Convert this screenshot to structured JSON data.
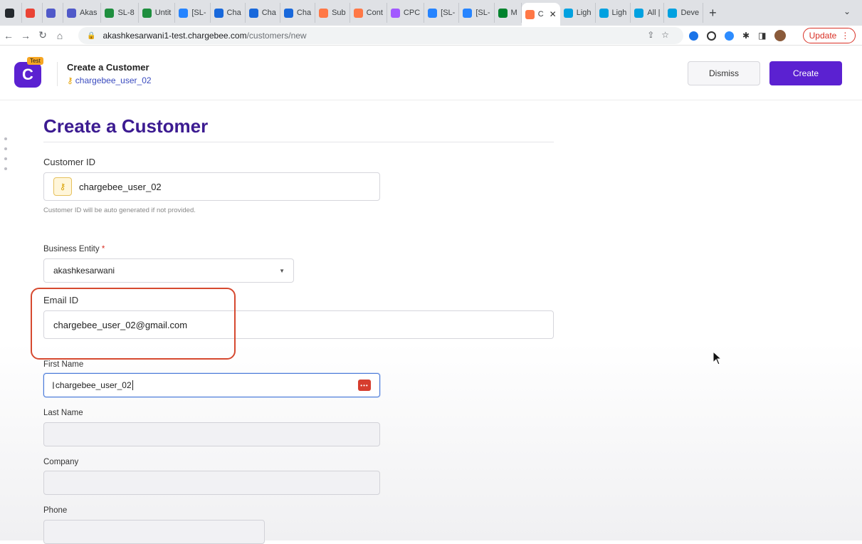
{
  "browser": {
    "tabs": [
      {
        "label": "",
        "icon": "github-icon",
        "color": "#24292e"
      },
      {
        "label": "",
        "icon": "gmail-icon",
        "color": "#ea4335"
      },
      {
        "label": "",
        "icon": "teams-icon",
        "color": "#5059c9"
      },
      {
        "label": "Akas",
        "icon": "teams-icon",
        "color": "#5059c9"
      },
      {
        "label": "SL-8",
        "icon": "sheets-icon",
        "color": "#1e8e3e"
      },
      {
        "label": "Untit",
        "icon": "sheets-icon",
        "color": "#1e8e3e"
      },
      {
        "label": "[SL-",
        "icon": "jira-icon",
        "color": "#2684ff"
      },
      {
        "label": "Cha",
        "icon": "confluence-icon",
        "color": "#1868db"
      },
      {
        "label": "Cha",
        "icon": "confluence-icon",
        "color": "#1868db"
      },
      {
        "label": "Cha",
        "icon": "confluence-icon",
        "color": "#1868db"
      },
      {
        "label": "Sub",
        "icon": "chargebee-icon",
        "color": "#ff7846"
      },
      {
        "label": "Cont",
        "icon": "chargebee-icon",
        "color": "#ff7846"
      },
      {
        "label": "CPC",
        "icon": "figma-icon",
        "color": "#a259ff"
      },
      {
        "label": "[SL-",
        "icon": "jira-icon",
        "color": "#2684ff"
      },
      {
        "label": "[SL-",
        "icon": "jira-icon",
        "color": "#2684ff"
      },
      {
        "label": "M",
        "icon": "meet-icon",
        "color": "#00832d"
      }
    ],
    "active_tab": {
      "label": "C",
      "icon": "chargebee-icon",
      "color": "#ff7846"
    },
    "tabs_after": [
      {
        "label": "Ligh",
        "icon": "salesforce-icon",
        "color": "#00a1e0"
      },
      {
        "label": "Ligh",
        "icon": "salesforce-icon",
        "color": "#00a1e0"
      },
      {
        "label": "All |",
        "icon": "salesforce-icon",
        "color": "#00a1e0"
      },
      {
        "label": "Deve",
        "icon": "salesforce-icon",
        "color": "#00a1e0"
      }
    ],
    "url_host": "akashkesarwani1-test.chargebee.com",
    "url_path": "/customers/new",
    "update_label": "Update"
  },
  "header": {
    "badge": "Test",
    "logo_letter": "C",
    "title": "Create a Customer",
    "subtitle": "chargebee_user_02",
    "dismiss_label": "Dismiss",
    "create_label": "Create",
    "accent": "#5b21d1"
  },
  "form": {
    "title": "Create a Customer",
    "customer_id_label": "Customer ID",
    "customer_id_value": "chargebee_user_02",
    "customer_id_hint": "Customer ID will be auto generated if not provided.",
    "business_entity_label": "Business Entity",
    "business_entity_required": "*",
    "business_entity_value": "akashkesarwani",
    "email_label": "Email ID",
    "email_value": "chargebee_user_02@gmail.com",
    "first_name_label": "First Name",
    "first_name_value": "chargebee_user_02",
    "last_name_label": "Last Name",
    "last_name_value": "",
    "company_label": "Company",
    "company_value": "",
    "phone_label": "Phone",
    "phone_value": ""
  }
}
